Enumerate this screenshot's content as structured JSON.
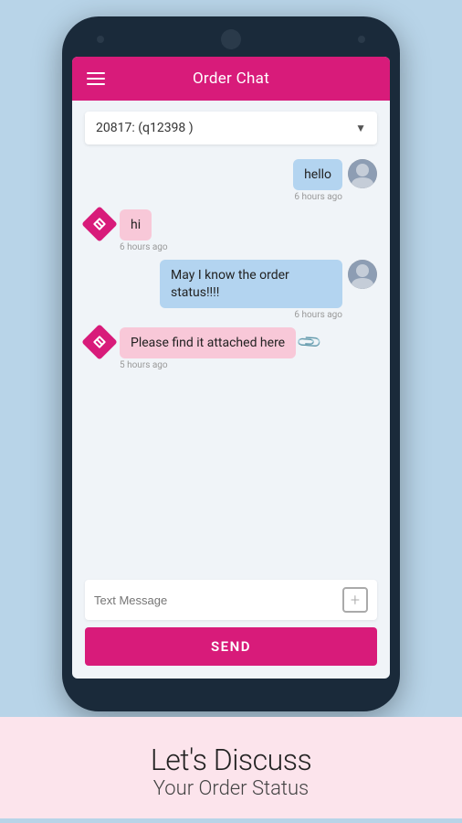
{
  "header": {
    "title": "Order Chat",
    "hamburger_label": "Menu"
  },
  "dropdown": {
    "value": "20817: (q12398 )",
    "arrow": "▼"
  },
  "messages": [
    {
      "id": 1,
      "side": "right",
      "text": "hello",
      "time": "6 hours ago",
      "avatar_type": "person",
      "has_attachment": false
    },
    {
      "id": 2,
      "side": "left",
      "text": "hi",
      "time": "6 hours ago",
      "avatar_type": "diamond",
      "has_attachment": false
    },
    {
      "id": 3,
      "side": "right",
      "text": "May I know the order status!!!!",
      "time": "6 hours ago",
      "avatar_type": "person",
      "has_attachment": false
    },
    {
      "id": 4,
      "side": "left",
      "text": "Please find it attached here",
      "time": "5 hours ago",
      "avatar_type": "diamond",
      "has_attachment": true
    }
  ],
  "input": {
    "placeholder": "Text Message"
  },
  "send_button": {
    "label": "SEND"
  },
  "bottom": {
    "title": "Let's Discuss",
    "subtitle": "Your Order Status"
  }
}
